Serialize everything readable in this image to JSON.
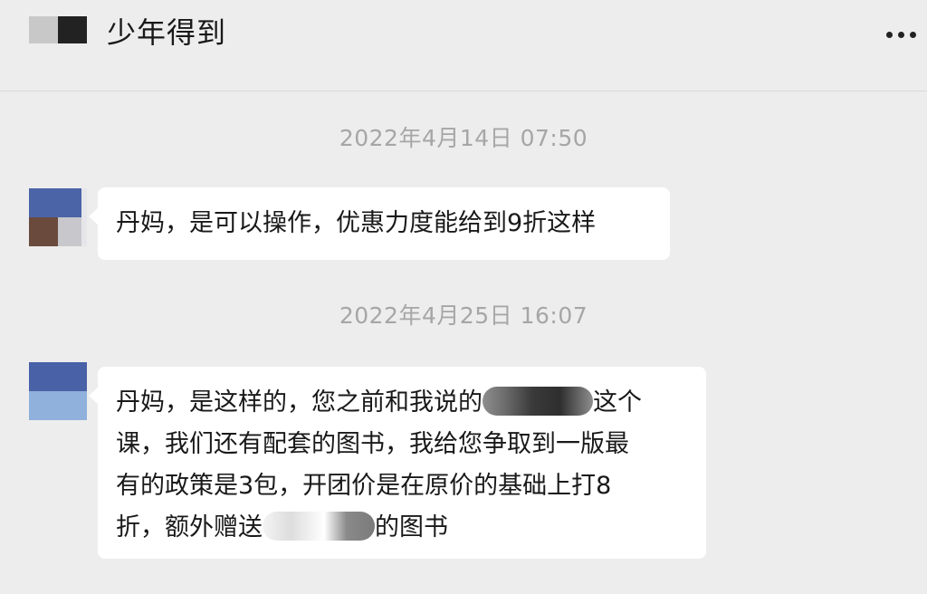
{
  "header": {
    "title": "少年得到",
    "more_icon": "more-dots-icon"
  },
  "messages": [
    {
      "timestamp": "2022年4月14日 07:50",
      "lines": [
        "丹妈，是可以操作，优惠力度能给到9折这样"
      ]
    },
    {
      "timestamp": "2022年4月25日 16:07",
      "line1_before": "丹妈，是这样的，您之前和我说的",
      "line1_after": "这个",
      "line2": "课，我们还有配套的图书，我给您争取到一版最",
      "line3": "有的政策是3包，开团价是在原价的基础上打8",
      "line4_before": "折，额外赠送",
      "line4_after": "的图书"
    }
  ],
  "colors": {
    "background": "#ededed",
    "bubble": "#ffffff",
    "timestamp_text": "#a6a6a6",
    "text": "#191919"
  }
}
